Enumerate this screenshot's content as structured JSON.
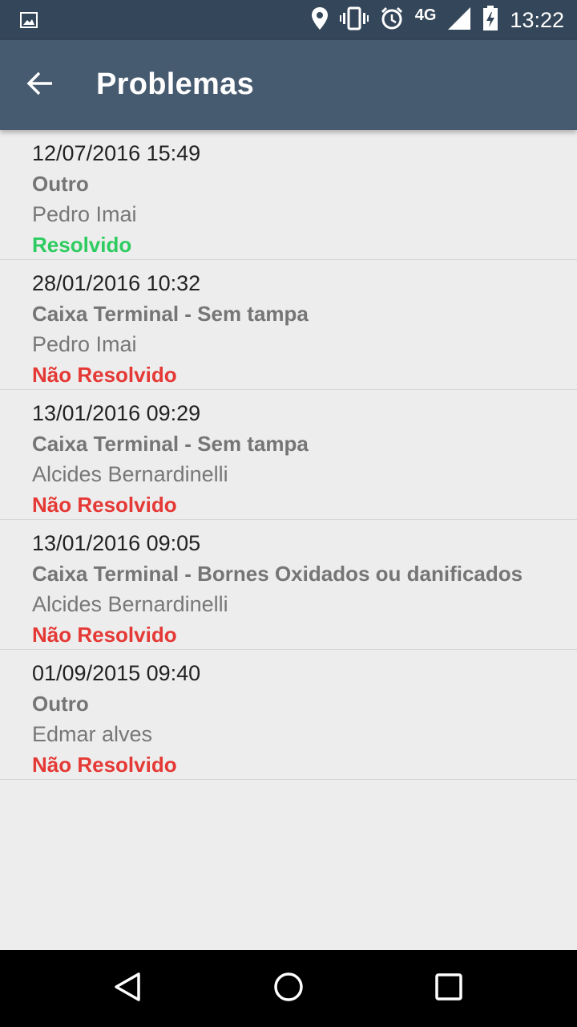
{
  "status_bar": {
    "time": "13:22",
    "network": "4G",
    "icons": [
      "image-icon",
      "location-icon",
      "vibrate-icon",
      "alarm-icon",
      "signal-icon",
      "battery-charging-icon"
    ]
  },
  "app_bar": {
    "title": "Problemas",
    "back_icon": "arrow-back-icon"
  },
  "colors": {
    "status_bar": "#344659",
    "app_bar": "#475b70",
    "resolved": "#2ecc60",
    "unresolved": "#e53935"
  },
  "problems": [
    {
      "datetime": "12/07/2016 15:49",
      "type": "Outro",
      "person": "Pedro Imai",
      "status": "Resolvido",
      "resolved": true
    },
    {
      "datetime": "28/01/2016 10:32",
      "type": "Caixa Terminal - Sem tampa",
      "person": "Pedro Imai",
      "status": "Não Resolvido",
      "resolved": false
    },
    {
      "datetime": "13/01/2016 09:29",
      "type": "Caixa Terminal - Sem tampa",
      "person": "Alcides Bernardinelli",
      "status": "Não Resolvido",
      "resolved": false
    },
    {
      "datetime": "13/01/2016 09:05",
      "type": "Caixa Terminal - Bornes Oxidados ou danificados",
      "person": "Alcides Bernardinelli",
      "status": "Não Resolvido",
      "resolved": false
    },
    {
      "datetime": "01/09/2015 09:40",
      "type": "Outro",
      "person": "Edmar alves",
      "status": "Não Resolvido",
      "resolved": false
    }
  ],
  "nav_bar": {
    "icons": [
      "back-triangle-icon",
      "home-circle-icon",
      "recents-square-icon"
    ]
  }
}
